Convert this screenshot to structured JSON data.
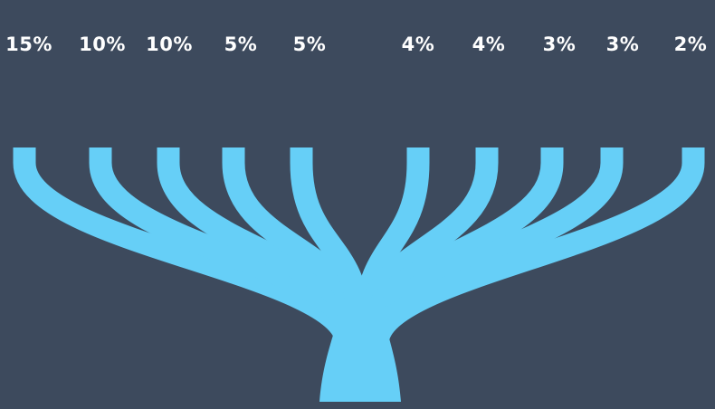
{
  "colors": {
    "background": "#3d4a5d",
    "branch": "#66cff7",
    "label": "#ffffff"
  },
  "branches": [
    {
      "label": "15%",
      "value": 15
    },
    {
      "label": "10%",
      "value": 10
    },
    {
      "label": "10%",
      "value": 10
    },
    {
      "label": "5%",
      "value": 5
    },
    {
      "label": "5%",
      "value": 5
    },
    {
      "label": "4%",
      "value": 4
    },
    {
      "label": "4%",
      "value": 4
    },
    {
      "label": "3%",
      "value": 3
    },
    {
      "label": "3%",
      "value": 3
    },
    {
      "label": "2%",
      "value": 2
    }
  ]
}
